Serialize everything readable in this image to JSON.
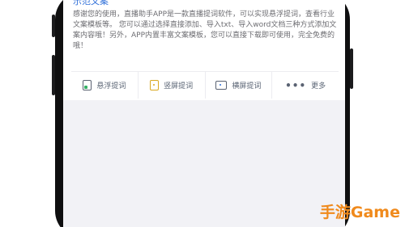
{
  "card": {
    "title": "示范文案",
    "description": "感谢您的使用，直播助手APP是一款直播提词软件，可以实现悬浮提词，查看行业文案模板等。 您可以通过选择直接添加、导入txt、导入word文档三种方式添加文案内容哦！另外，APP内置丰富文案模板，您可以直接下载即可使用，完全免费的哦！"
  },
  "actions": [
    {
      "label": "悬浮提词",
      "icon": "float-window-icon"
    },
    {
      "label": "竖屏提词",
      "icon": "portrait-screen-icon"
    },
    {
      "label": "横屏提词",
      "icon": "landscape-screen-icon"
    },
    {
      "label": "更多",
      "icon": "more-dots-icon",
      "glyph": "•••"
    }
  ],
  "watermark": {
    "text": "手游Game"
  }
}
